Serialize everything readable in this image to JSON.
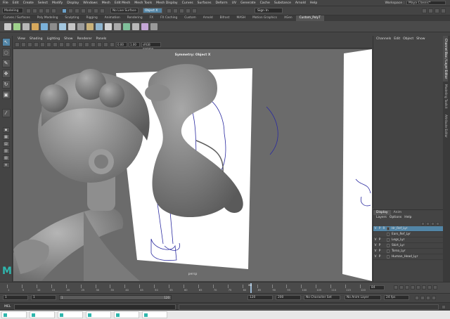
{
  "menubar": {
    "items": [
      "File",
      "Edit",
      "Create",
      "Select",
      "Modify",
      "Display",
      "Windows",
      "Mesh",
      "Edit Mesh",
      "Mesh Tools",
      "Mesh Display",
      "Curves",
      "Surfaces",
      "Deform",
      "UV",
      "Generate",
      "Cache",
      "Substance",
      "Arnold",
      "Help"
    ],
    "workspace_label": "Workspace :",
    "workspace_value": "Maya Classic*"
  },
  "statusline": {
    "mode": "Modeling",
    "live_surface": "No Live Surface",
    "symmetry": "Object X",
    "sign_in": "Sign In"
  },
  "shelf": {
    "tabs": [
      "Curves / Surfaces",
      "Poly Modeling",
      "Sculpting",
      "Rigging",
      "Animation",
      "Rendering",
      "FX",
      "FX Caching",
      "Custom",
      "Arnold",
      "Bifrost",
      "MASH",
      "Motion Graphics",
      "XGen",
      "Custom_PolyT"
    ],
    "active_tab": "Custom_PolyT"
  },
  "viewport": {
    "menu": [
      "View",
      "Shading",
      "Lighting",
      "Show",
      "Renderer",
      "Panels"
    ],
    "title": "Symmetry: Object X",
    "camera": "persp",
    "near_value": "0.00",
    "far_value": "1.00",
    "color_space": "sRGB gamma"
  },
  "channel_box": {
    "menu": [
      "Channels",
      "Edit",
      "Object",
      "Show"
    ]
  },
  "side_tabs": [
    "Channel Box / Layer Editor",
    "Modeling Toolkit",
    "Attribute Editor"
  ],
  "layer_editor": {
    "tabs": [
      "Display",
      "Anim"
    ],
    "active_tab": "Display",
    "menu": [
      "Layers",
      "Options",
      "Help"
    ],
    "layers": [
      {
        "v": "V",
        "p": "P",
        "r": "R",
        "name": "Hr_Ref_Lyr",
        "selected": true
      },
      {
        "v": "",
        "p": "",
        "r": "",
        "name": "Ears_Ref_Lyr",
        "selected": false
      },
      {
        "v": "V",
        "p": "P",
        "r": "",
        "name": "Legs_Lyr",
        "selected": false
      },
      {
        "v": "V",
        "p": "P",
        "r": "",
        "name": "Skirt_Lyr",
        "selected": false
      },
      {
        "v": "V",
        "p": "P",
        "r": "",
        "name": "Torso_Lyr",
        "selected": false
      },
      {
        "v": "V",
        "p": "P",
        "r": "",
        "name": "Human_Head_Lyr",
        "selected": false
      }
    ]
  },
  "timeline": {
    "ticks": [
      "1",
      "5",
      "10",
      "15",
      "20",
      "25",
      "30",
      "35",
      "40",
      "45",
      "50",
      "55",
      "60",
      "65",
      "70",
      "75",
      "80",
      "85",
      "90",
      "95",
      "100",
      "105",
      "110",
      "115",
      "120"
    ],
    "current_frame": "84",
    "current_frame_fraction": 0.69
  },
  "range": {
    "start": "1",
    "start2": "1",
    "playback_start_marker": "1",
    "range_end_marker": "120",
    "end": "120",
    "end2": "200",
    "character_set": "No Character Set",
    "anim_layer": "No Anim Layer",
    "fps": "24 fps"
  },
  "mel": {
    "label": "MEL"
  },
  "taskbar": {
    "items": [
      "",
      "",
      "",
      "",
      "",
      ""
    ]
  },
  "colors": {
    "accent": "#5285a6",
    "maya_logo": "#2fb6ad",
    "sketch_line": "#2a2aa0"
  }
}
